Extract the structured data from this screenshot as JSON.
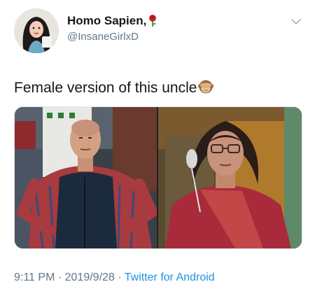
{
  "author": {
    "display_name": "Homo Sapien,",
    "handle": "@InsaneGirlxD",
    "badge_icon": "rose-icon"
  },
  "tweet": {
    "text": "Female version of this uncle",
    "emoji_icon": "see-no-evil-monkey-icon"
  },
  "media": {
    "left_photo": "man-in-vest-photo",
    "right_photo": "woman-in-saree-photo"
  },
  "footer": {
    "time": "9:11 PM",
    "separator": " · ",
    "date": "2019/9/28",
    "separator2": " · ",
    "source": "Twitter for Android"
  },
  "colors": {
    "text": "#14171a",
    "secondary": "#657786",
    "link": "#1b95e0"
  }
}
